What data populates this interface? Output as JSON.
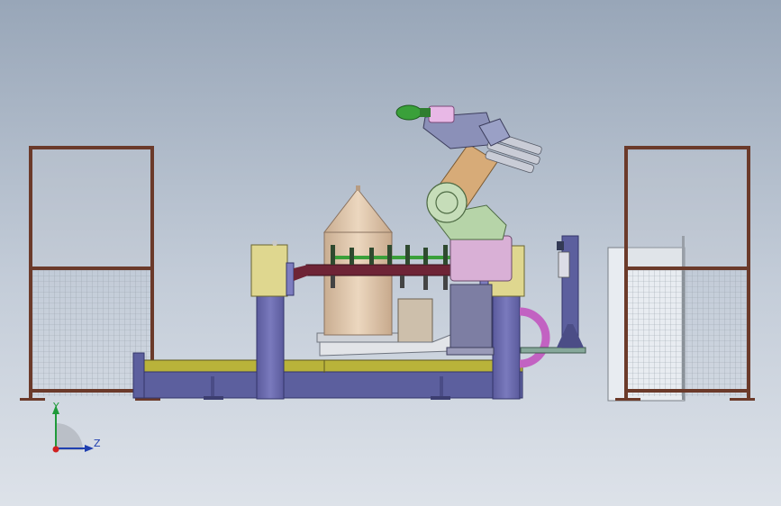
{
  "triad": {
    "y_label": "Y",
    "z_label": "Z"
  },
  "colors": {
    "frame": "#6b3a2a",
    "mesh": "#9aa3ad",
    "base_yellow": "#b9b33a",
    "base_blue": "#5c5f9e",
    "column_blue": "#6f6fb0",
    "box_yellow": "#dfd78f",
    "cone": "#e2c9ad",
    "robot_green": "#b6d4a8",
    "robot_orange": "#d7ab78",
    "robot_pink": "#d9b0d6",
    "fixture_maroon": "#6e2436",
    "gripper_green": "#3aa03a",
    "ring_magenta": "#c262c2"
  }
}
